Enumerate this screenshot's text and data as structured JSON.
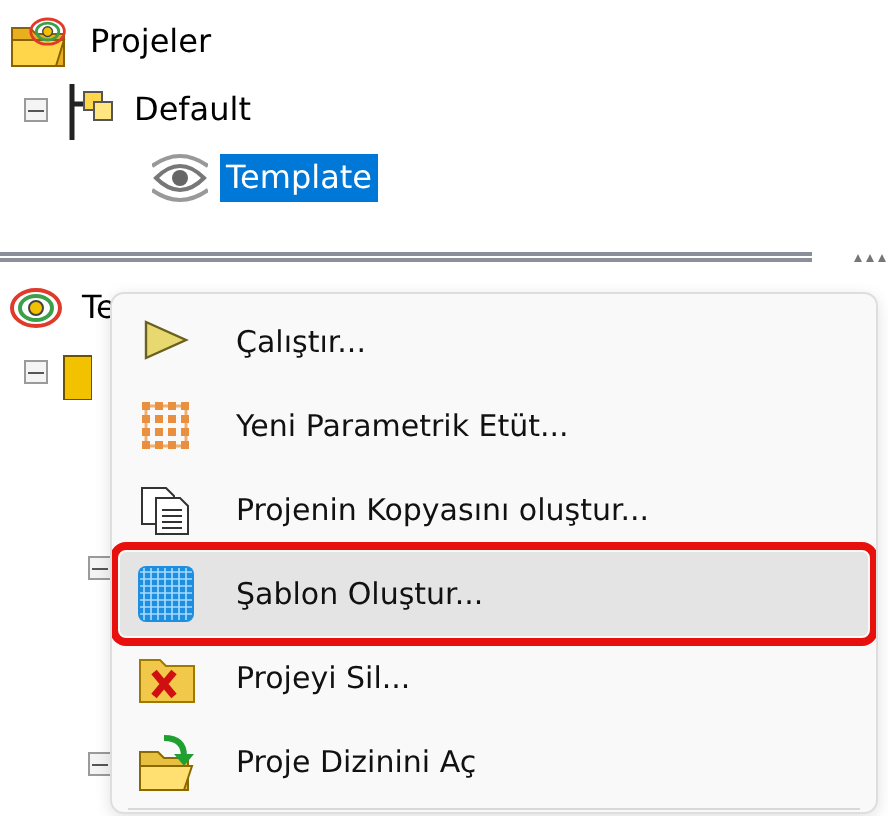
{
  "project_tree": {
    "label": "Projeler",
    "children": [
      {
        "label": "Default",
        "expanded": true,
        "children": [
          {
            "label": "Template",
            "selected": true
          }
        ]
      }
    ]
  },
  "detail_tree": {
    "label": "Te",
    "nodes": [
      {
        "expanded": true
      },
      {
        "expanded": true
      },
      {
        "expanded": true
      }
    ]
  },
  "context_menu": {
    "items": [
      {
        "kind": "run",
        "label": "Çalıştır...",
        "hovered": false,
        "outlined": false
      },
      {
        "kind": "study",
        "label": "Yeni Parametrik Etüt...",
        "hovered": false,
        "outlined": false
      },
      {
        "kind": "copy",
        "label": "Projenin Kopyasını oluştur...",
        "hovered": false,
        "outlined": false
      },
      {
        "kind": "template",
        "label": "Şablon Oluştur...",
        "hovered": true,
        "outlined": true
      },
      {
        "kind": "delete",
        "label": "Projeyi Sil...",
        "hovered": false,
        "outlined": false
      },
      {
        "kind": "open",
        "label": "Proje Dizinini Aç",
        "hovered": false,
        "outlined": false
      }
    ]
  }
}
